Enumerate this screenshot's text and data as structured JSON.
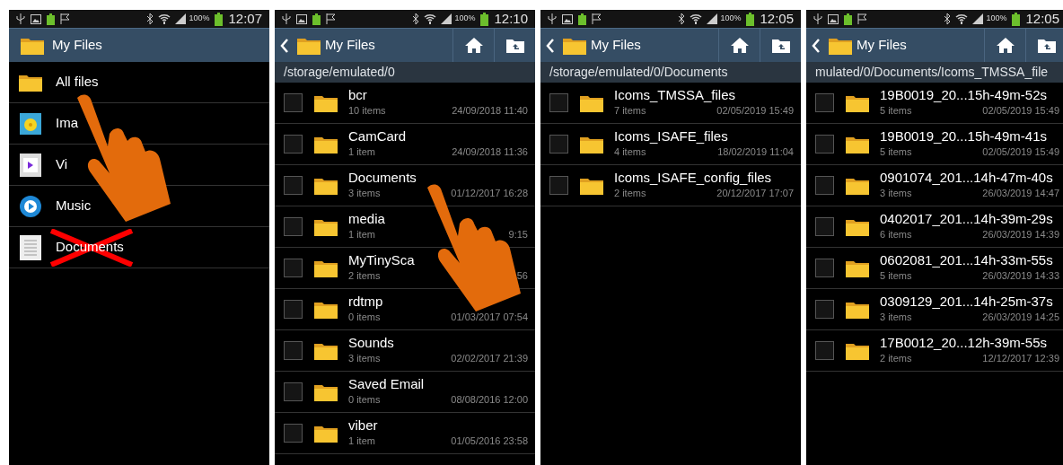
{
  "panels": [
    {
      "status": {
        "battery": "100%",
        "time": "12:07"
      },
      "header": {
        "title": "My Files",
        "back": false,
        "actions": false
      },
      "items": [
        {
          "kind": "folder",
          "label": "All files"
        },
        {
          "kind": "images",
          "label": "Ima"
        },
        {
          "kind": "videos",
          "label": "Vi"
        },
        {
          "kind": "music",
          "label": "Music"
        },
        {
          "kind": "documents",
          "label": "Documents",
          "crossed": true
        }
      ]
    },
    {
      "status": {
        "battery": "100%",
        "time": "12:10"
      },
      "header": {
        "title": "My Files",
        "back": true,
        "actions": true
      },
      "path": "/storage/emulated/0",
      "files": [
        {
          "name": "bcr",
          "count": "10 items",
          "date": "24/09/2018 11:40",
          "checked": false
        },
        {
          "name": "CamCard",
          "count": "1 item",
          "date": "24/09/2018 11:36",
          "checked": false
        },
        {
          "name": "Documents",
          "count": "3 items",
          "date": "01/12/2017 16:28",
          "checked": false
        },
        {
          "name": "media",
          "count": "1 item",
          "date": "9:15",
          "checked": false
        },
        {
          "name": "MyTinySca",
          "count": "2 items",
          "date": "56",
          "checked": false
        },
        {
          "name": "rdtmp",
          "count": "0 items",
          "date": "01/03/2017 07:54",
          "checked": false
        },
        {
          "name": "Sounds",
          "count": "3 items",
          "date": "02/02/2017 21:39",
          "checked": false
        },
        {
          "name": "Saved Email",
          "count": "0 items",
          "date": "08/08/2016 12:00",
          "checked": false
        },
        {
          "name": "viber",
          "count": "1 item",
          "date": "01/05/2016 23:58",
          "checked": false
        }
      ]
    },
    {
      "status": {
        "battery": "100%",
        "time": "12:05"
      },
      "header": {
        "title": "My Files",
        "back": true,
        "actions": true
      },
      "path": "/storage/emulated/0/Documents",
      "files": [
        {
          "name": "Icoms_TMSSA_files",
          "count": "7 items",
          "date": "02/05/2019 15:49",
          "checked": false
        },
        {
          "name": "Icoms_ISAFE_files",
          "count": "4 items",
          "date": "18/02/2019 11:04",
          "checked": false
        },
        {
          "name": "Icoms_ISAFE_config_files",
          "count": "2 items",
          "date": "20/12/2017 17:07",
          "checked": false
        }
      ]
    },
    {
      "status": {
        "battery": "100%",
        "time": "12:05"
      },
      "header": {
        "title": "My Files",
        "back": true,
        "actions": true
      },
      "path": "mulated/0/Documents/Icoms_TMSSA_file",
      "files": [
        {
          "name": "19B0019_20...15h-49m-52s",
          "count": "5 items",
          "date": "02/05/2019 15:49",
          "checked": false
        },
        {
          "name": "19B0019_20...15h-49m-41s",
          "count": "5 items",
          "date": "02/05/2019 15:49",
          "checked": false
        },
        {
          "name": "0901074_201...14h-47m-40s",
          "count": "3 items",
          "date": "26/03/2019 14:47",
          "checked": false
        },
        {
          "name": "0402017_201...14h-39m-29s",
          "count": "6 items",
          "date": "26/03/2019 14:39",
          "checked": false
        },
        {
          "name": "0602081_201...14h-33m-55s",
          "count": "5 items",
          "date": "26/03/2019 14:33",
          "checked": false
        },
        {
          "name": "0309129_201...14h-25m-37s",
          "count": "3 items",
          "date": "26/03/2019 14:25",
          "checked": false
        },
        {
          "name": "17B0012_20...12h-39m-55s",
          "count": "2 items",
          "date": "12/12/2017 12:39",
          "checked": false
        }
      ]
    }
  ]
}
